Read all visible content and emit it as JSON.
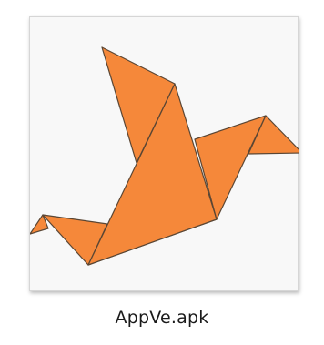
{
  "file": {
    "name": "AppVe.apk",
    "icon": "origami-bird-icon",
    "icon_fill": "#f5883a",
    "icon_stroke": "#5a4634"
  }
}
